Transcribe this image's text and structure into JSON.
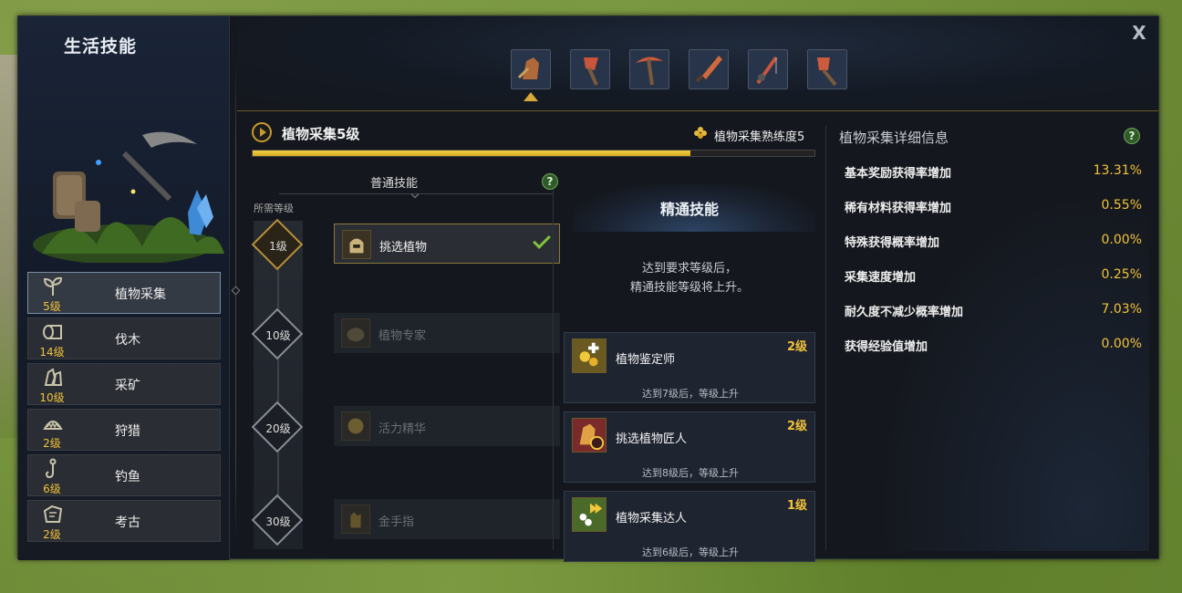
{
  "sidebar": {
    "title": "生活技能",
    "items": [
      {
        "name": "植物采集",
        "level": "5级",
        "icon": "sprout-icon"
      },
      {
        "name": "伐木",
        "level": "14级",
        "icon": "log-icon"
      },
      {
        "name": "采矿",
        "level": "10级",
        "icon": "ore-icon"
      },
      {
        "name": "狩猎",
        "level": "2级",
        "icon": "trap-icon"
      },
      {
        "name": "钓鱼",
        "level": "6级",
        "icon": "fishhook-icon"
      },
      {
        "name": "考古",
        "level": "2级",
        "icon": "stone-tablet-icon"
      }
    ]
  },
  "toolbar": {
    "tools": [
      "gathering-glove-icon",
      "axe-icon",
      "pickaxe-icon",
      "dagger-icon",
      "fishing-rod-icon",
      "shovel-icon"
    ],
    "close_label": "X"
  },
  "header": {
    "title": "植物采集5级",
    "proficiency_label": "植物采集熟练度5",
    "progress": 0.78
  },
  "normal": {
    "title": "普通技能",
    "help": "?",
    "req_label": "所需等级",
    "skills": [
      {
        "level": "1级",
        "name": "挑选植物",
        "unlocked": true
      },
      {
        "level": "10级",
        "name": "植物专家",
        "unlocked": false
      },
      {
        "level": "20级",
        "name": "活力精华",
        "unlocked": false
      },
      {
        "level": "30级",
        "name": "金手指",
        "unlocked": false
      }
    ]
  },
  "master": {
    "title": "精通技能",
    "desc_line1": "达到要求等级后，",
    "desc_line2": "精通技能等级将上升。",
    "skills": [
      {
        "name": "植物鉴定师",
        "level": "2级",
        "note": "达到7级后，等级上升"
      },
      {
        "name": "挑选植物匠人",
        "level": "2级",
        "note": "达到8级后，等级上升"
      },
      {
        "name": "植物采集达人",
        "level": "1级",
        "note": "达到6级后，等级上升"
      }
    ]
  },
  "details": {
    "title": "植物采集详细信息",
    "help": "?",
    "stats": [
      {
        "label": "基本奖励获得率增加",
        "value": "13.31%"
      },
      {
        "label": "稀有材料获得率增加",
        "value": "0.55%"
      },
      {
        "label": "特殊获得概率增加",
        "value": "0.00%"
      },
      {
        "label": "采集速度增加",
        "value": "0.25%"
      },
      {
        "label": "耐久度不减少概率增加",
        "value": "7.03%"
      },
      {
        "label": "获得经验值增加",
        "value": "0.00%"
      }
    ]
  },
  "colors": {
    "accent_gold": "#f2c23a",
    "check_green": "#7fc23a",
    "panel": "#14171d"
  }
}
